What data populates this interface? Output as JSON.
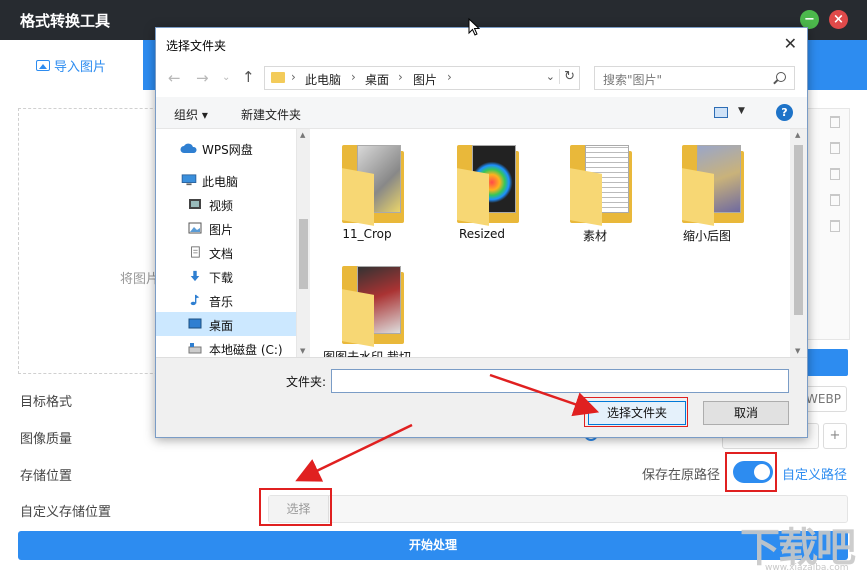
{
  "app": {
    "title": "格式转换工具",
    "import_tab_label": "导入图片",
    "drop_hint": "将图片"
  },
  "settings": {
    "target_format_label": "目标格式",
    "target_format_value": "WEBP",
    "quality_label": "图像质量",
    "quality_plus": "+",
    "storage_label": "存储位置",
    "keep_original_path_label": "保存在原路径",
    "keep_original_path_on": true,
    "custom_path_link": "自定义路径",
    "custom_storage_label": "自定义存储位置",
    "choose_button": "选择",
    "start_button": "开始处理"
  },
  "dialog": {
    "title": "选择文件夹",
    "close": "✕",
    "breadcrumb": [
      "此电脑",
      "桌面",
      "图片"
    ],
    "search_placeholder": "搜索\"图片\"",
    "organize_label": "组织 ▾",
    "new_folder_label": "新建文件夹",
    "nav_items": [
      {
        "label": "WPS网盘",
        "icon": "cloud-icon"
      },
      {
        "label": "此电脑",
        "icon": "computer-icon"
      },
      {
        "label": "视频",
        "icon": "video-icon"
      },
      {
        "label": "图片",
        "icon": "picture-icon"
      },
      {
        "label": "文档",
        "icon": "document-icon"
      },
      {
        "label": "下载",
        "icon": "download-icon"
      },
      {
        "label": "音乐",
        "icon": "music-icon"
      },
      {
        "label": "桌面",
        "icon": "desktop-icon",
        "selected": true
      },
      {
        "label": "本地磁盘 (C:)",
        "icon": "disk-icon"
      }
    ],
    "folders": [
      {
        "name": "11_Crop"
      },
      {
        "name": "Resized"
      },
      {
        "name": "素材"
      },
      {
        "name": "缩小后图"
      },
      {
        "name": "图图去水印 裁切"
      }
    ],
    "folder_field_label": "文件夹:",
    "folder_field_value": "",
    "select_button": "选择文件夹",
    "cancel_button": "取消"
  },
  "watermark": {
    "text": "下载吧",
    "sub": "www.xiazaiba.com"
  },
  "colors": {
    "accent": "#2d8cf0",
    "titlebar": "#272b30",
    "highlight": "#e02020"
  }
}
